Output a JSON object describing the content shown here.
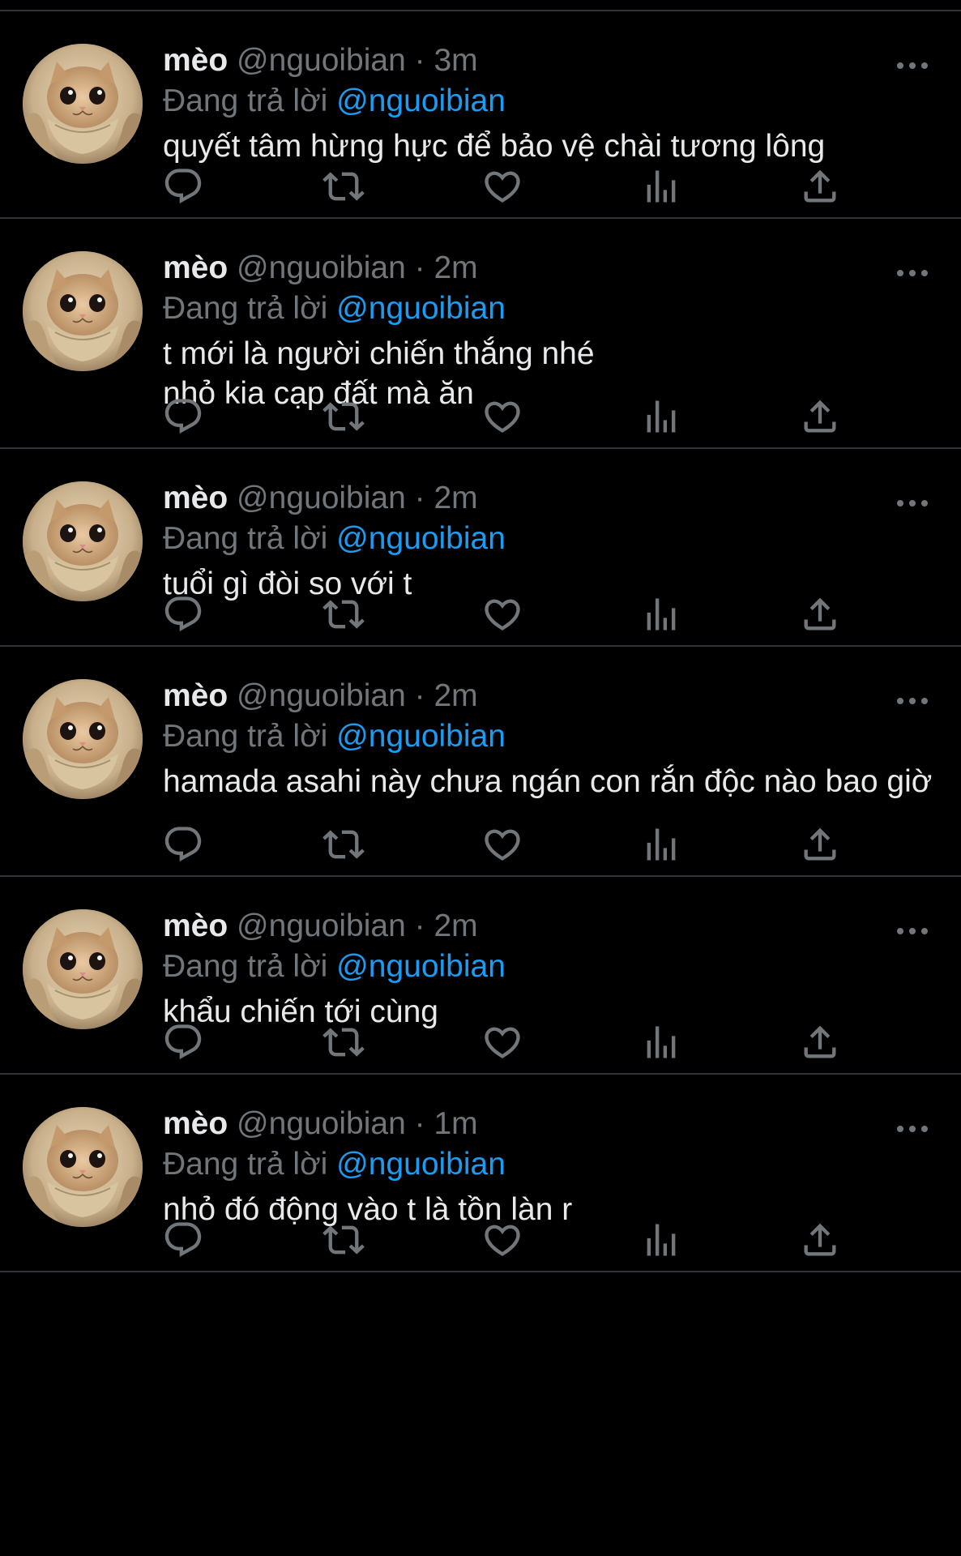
{
  "colors": {
    "background": "#000000",
    "divider": "#2f3336",
    "primary_text": "#e7e9ea",
    "secondary_text": "#71767b",
    "accent": "#1d9bf0"
  },
  "icons": {
    "more": "more-icon",
    "reply": "reply-icon",
    "retweet": "retweet-icon",
    "like": "like-icon",
    "views": "views-icon",
    "share": "share-icon"
  },
  "tweets": [
    {
      "name": "mèo",
      "handle": "@nguoibian",
      "separator": "·",
      "time": "3m",
      "reply_prefix": "Đang trả lời",
      "reply_to": "@nguoibian",
      "text": "quyết tâm hừng hực để bảo vệ chài tương lông"
    },
    {
      "name": "mèo",
      "handle": "@nguoibian",
      "separator": "·",
      "time": "2m",
      "reply_prefix": "Đang trả lời",
      "reply_to": "@nguoibian",
      "text": "t mới là người chiến thắng nhé\nnhỏ kia cạp đất mà ăn"
    },
    {
      "name": "mèo",
      "handle": "@nguoibian",
      "separator": "·",
      "time": "2m",
      "reply_prefix": "Đang trả lời",
      "reply_to": "@nguoibian",
      "text": "tuổi gì đòi so với t"
    },
    {
      "name": "mèo",
      "handle": "@nguoibian",
      "separator": "·",
      "time": "2m",
      "reply_prefix": "Đang trả lời",
      "reply_to": "@nguoibian",
      "text": "hamada asahi này chưa ngán con rắn độc nào bao giờ"
    },
    {
      "name": "mèo",
      "handle": "@nguoibian",
      "separator": "·",
      "time": "2m",
      "reply_prefix": "Đang trả lời",
      "reply_to": "@nguoibian",
      "text": "khẩu chiến tới cùng"
    },
    {
      "name": "mèo",
      "handle": "@nguoibian",
      "separator": "·",
      "time": "1m",
      "reply_prefix": "Đang trả lời",
      "reply_to": "@nguoibian",
      "text": "nhỏ đó động vào t là tồn làn r"
    }
  ]
}
